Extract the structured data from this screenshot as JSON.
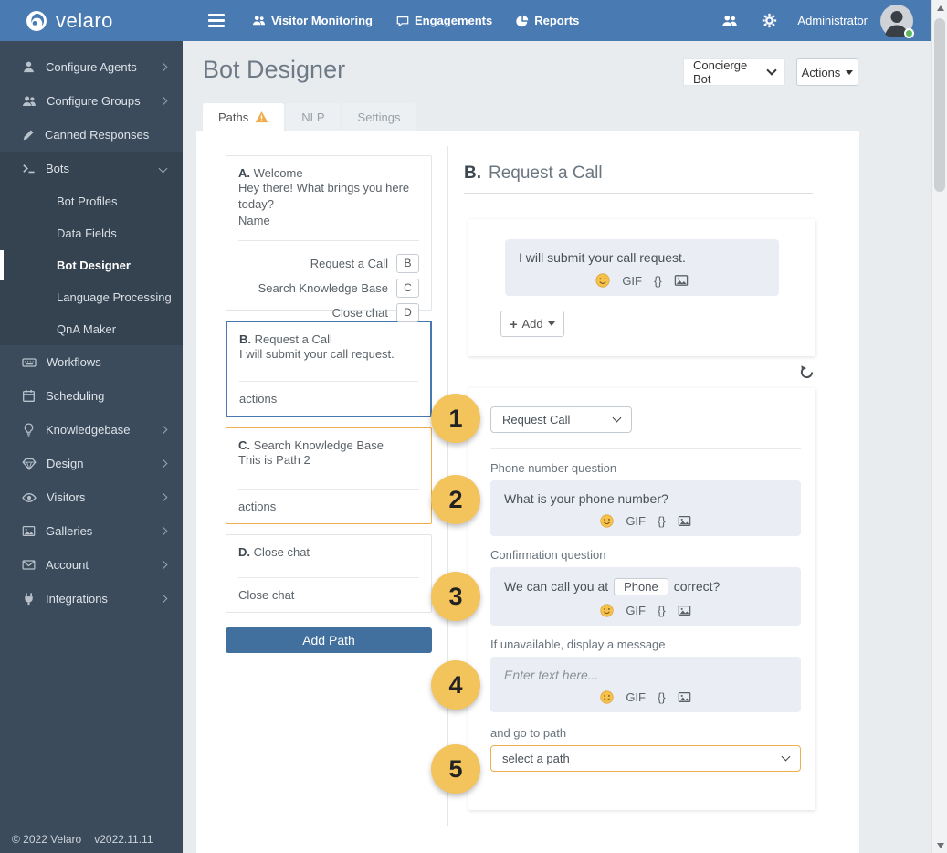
{
  "colors": {
    "topbar_blue": "#4a7ab2",
    "sidebar_dark": "#3b4b5c",
    "selected_card_blue": "#4878ad",
    "warning_orange": "#f0ad4e",
    "step_circle_yellow": "#f3c35c",
    "add_path_blue": "#41709f",
    "status_green": "#5cb85c"
  },
  "topbar": {
    "brand": "velaro",
    "nav": [
      {
        "label": "Visitor Monitoring"
      },
      {
        "label": "Engagements"
      },
      {
        "label": "Reports"
      }
    ],
    "user": "Administrator"
  },
  "sidebar": {
    "items": [
      {
        "label": "Configure Agents"
      },
      {
        "label": "Configure Groups"
      },
      {
        "label": "Canned Responses"
      },
      {
        "label": "Bots"
      },
      {
        "label": "Workflows"
      },
      {
        "label": "Scheduling"
      },
      {
        "label": "Knowledgebase"
      },
      {
        "label": "Design"
      },
      {
        "label": "Visitors"
      },
      {
        "label": "Galleries"
      },
      {
        "label": "Account"
      },
      {
        "label": "Integrations"
      }
    ],
    "submenu": [
      "Bot Profiles",
      "Data Fields",
      "Bot Designer",
      "Language Processing",
      "QnA Maker"
    ],
    "footer": {
      "copyright": "© 2022 Velaro",
      "version": "v2022.11.11"
    }
  },
  "header": {
    "title": "Bot Designer",
    "bot_select": "Concierge Bot",
    "actions_label": "Actions"
  },
  "tabs": [
    {
      "label": "Paths"
    },
    {
      "label": "NLP"
    },
    {
      "label": "Settings"
    }
  ],
  "paths": [
    {
      "letter": "A.",
      "title": "Welcome",
      "body": "Hey there! What brings you here today?",
      "body2": "Name",
      "links": [
        {
          "label": "Request a Call",
          "badge": "B"
        },
        {
          "label": "Search Knowledge Base",
          "badge": "C"
        },
        {
          "label": "Close chat",
          "badge": "D"
        }
      ]
    },
    {
      "letter": "B.",
      "title": "Request a Call",
      "body": "I will submit your call request.",
      "footer": "actions"
    },
    {
      "letter": "C.",
      "title": "Search Knowledge Base",
      "body": "This is Path 2",
      "footer": "actions"
    },
    {
      "letter": "D.",
      "title": "Close chat",
      "footer": "Close chat"
    }
  ],
  "add_path_label": "Add Path",
  "editor": {
    "letter": "B.",
    "title": "Request a Call",
    "message": "I will submit your call request.",
    "toolbar": {
      "gif_label": "GIF",
      "vars_label": "{}"
    },
    "add_plus": "+",
    "add_label": "Add"
  },
  "steps": [
    {
      "num": "1",
      "select": "Request Call"
    },
    {
      "num": "2",
      "label": "Phone number question",
      "text": "What is your phone number?"
    },
    {
      "num": "3",
      "label": "Confirmation question",
      "text_before": "We can call you at",
      "chip": "Phone",
      "text_after": "correct?"
    },
    {
      "num": "4",
      "label": "If unavailable, display a message",
      "placeholder": "Enter text here..."
    },
    {
      "num": "5",
      "label": "and go to path",
      "select": "select a path"
    }
  ]
}
